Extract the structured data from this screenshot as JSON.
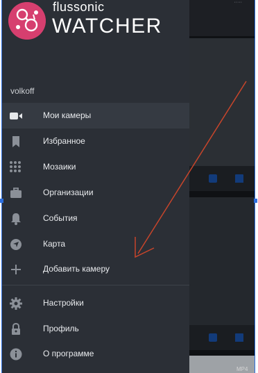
{
  "app": {
    "brand_small": "flussonic",
    "brand_big": "WATCHER",
    "user": "volkoff",
    "accent": "#d63f6f",
    "overlay_label": "MP4"
  },
  "menu": [
    {
      "label": "Мои камеры",
      "icon": "video-camera-icon",
      "active": true
    },
    {
      "label": "Избранное",
      "icon": "bookmark-icon"
    },
    {
      "label": "Мозаики",
      "icon": "grid-dots-icon"
    },
    {
      "label": "Организации",
      "icon": "briefcase-icon"
    },
    {
      "label": "События",
      "icon": "bell-icon"
    },
    {
      "label": "Карта",
      "icon": "navigation-arrow-icon"
    },
    {
      "label": "Добавить камеру",
      "icon": "plus-icon"
    }
  ],
  "menu_secondary": [
    {
      "label": "Настройки",
      "icon": "gear-icon"
    },
    {
      "label": "Профиль",
      "icon": "lock-icon"
    },
    {
      "label": "О программе",
      "icon": "info-icon"
    }
  ],
  "annotation": {
    "color": "#c8452b",
    "shape": "arrow"
  }
}
